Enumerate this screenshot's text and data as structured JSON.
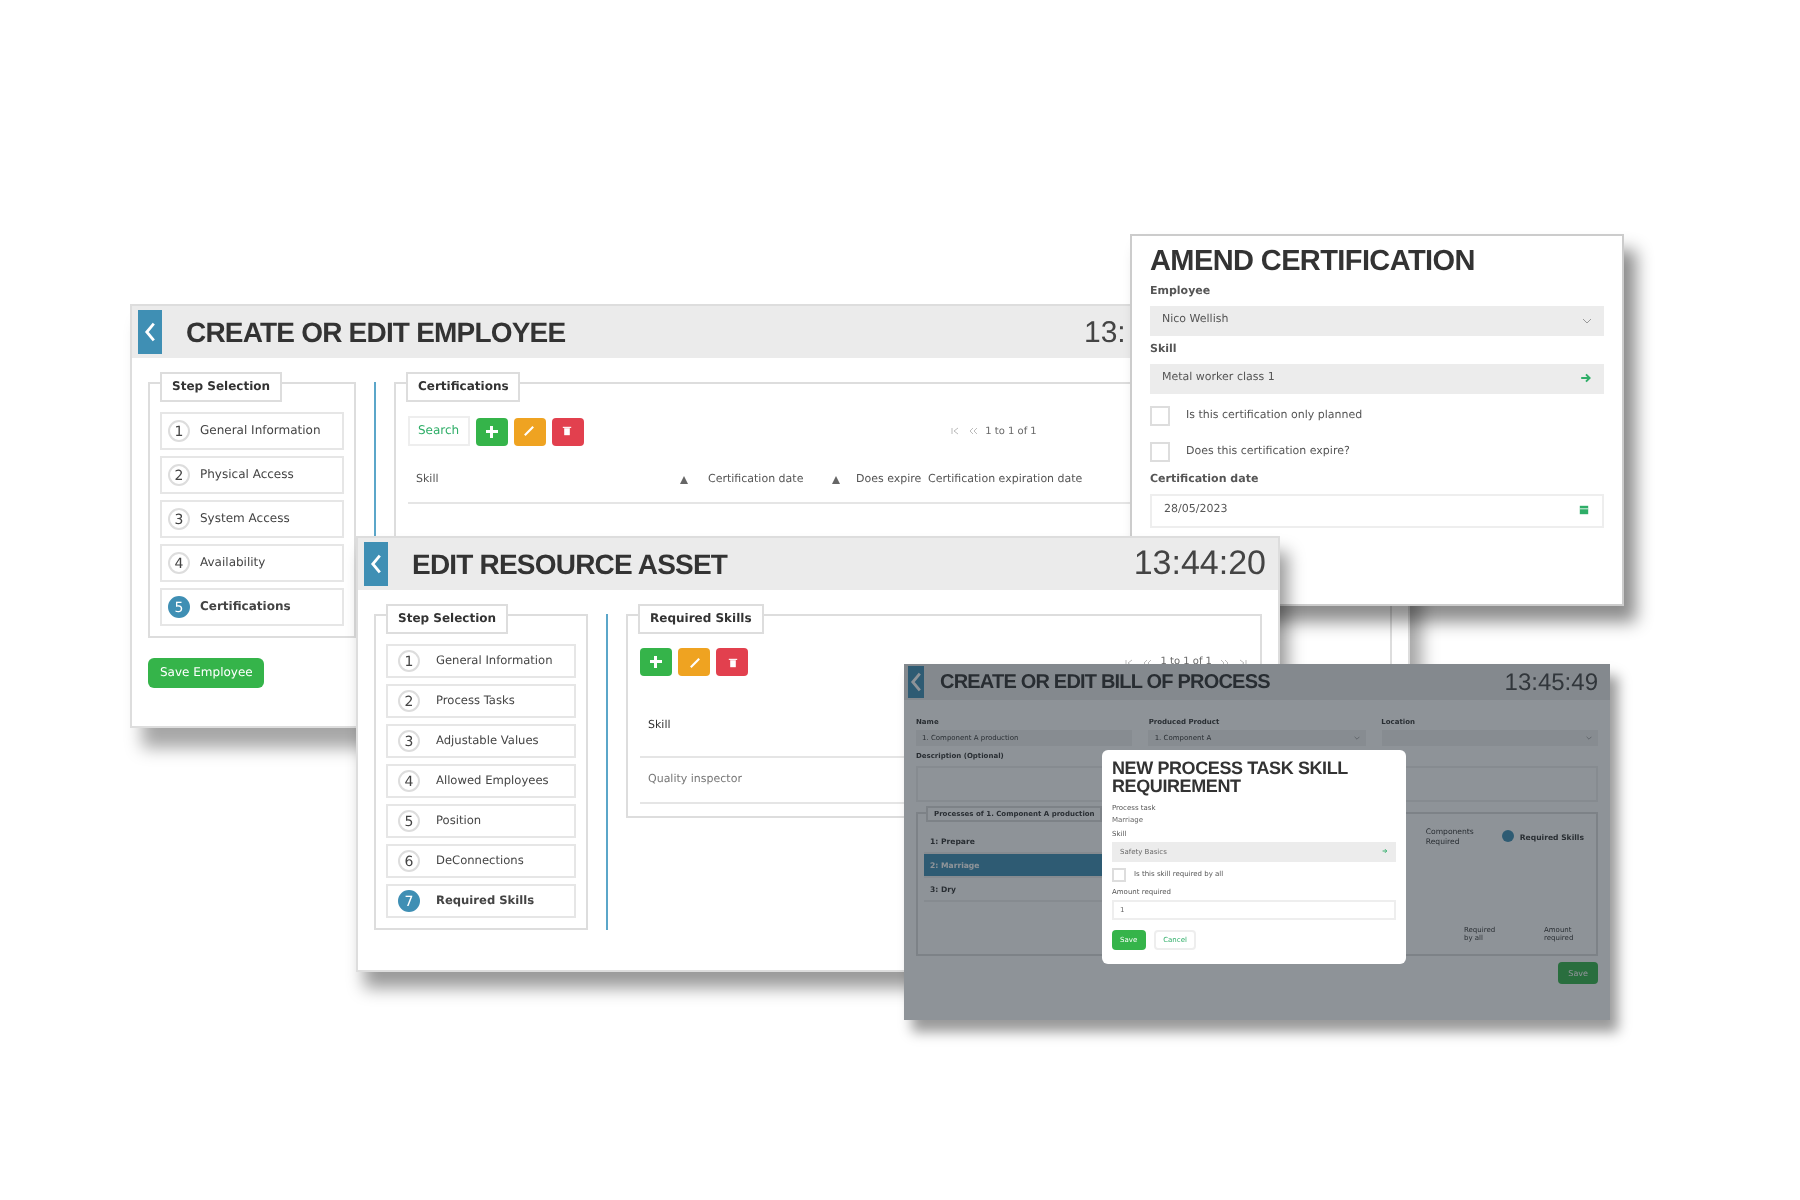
{
  "employee_window": {
    "title": "CREATE OR EDIT EMPLOYEE",
    "clock": "13:",
    "steps_title": "Step Selection",
    "steps": [
      {
        "number": "1",
        "label": "General Information",
        "selected": false
      },
      {
        "number": "2",
        "label": "Physical Access",
        "selected": false
      },
      {
        "number": "3",
        "label": "System Access",
        "selected": false
      },
      {
        "number": "4",
        "label": "Availability",
        "selected": false
      },
      {
        "number": "5",
        "label": "Certifications",
        "selected": true
      }
    ],
    "save_button": "Save Employee",
    "panel_title": "Certifications",
    "search_button": "Search",
    "pager": "1 to 1 of 1",
    "columns": [
      {
        "label": "Skill",
        "sortable": true
      },
      {
        "label": "Certification date",
        "sortable": true
      },
      {
        "label": "Does expire",
        "sortable": false
      },
      {
        "label": "Certification expiration date",
        "sortable": false
      }
    ]
  },
  "amend_certification_dialog": {
    "title": "AMEND CERTIFICATION",
    "fields": [
      {
        "kind": "select",
        "label": "Employee",
        "value": "Nico Wellish"
      },
      {
        "kind": "lookup",
        "label": "Skill",
        "value": "Metal worker class 1"
      },
      {
        "kind": "checkbox",
        "label": "Is this certification only planned",
        "checked": false
      },
      {
        "kind": "checkbox",
        "label": "Does this certification expire?",
        "checked": false
      },
      {
        "kind": "date",
        "label": "Certification date",
        "value": "28/05/2023"
      }
    ]
  },
  "resource_asset_window": {
    "title": "EDIT RESOURCE ASSET",
    "clock": "13:44:20",
    "steps_title": "Step Selection",
    "steps": [
      {
        "number": "1",
        "label": "General Information",
        "selected": false
      },
      {
        "number": "2",
        "label": "Process Tasks",
        "selected": false
      },
      {
        "number": "3",
        "label": "Adjustable Values",
        "selected": false
      },
      {
        "number": "4",
        "label": "Allowed Employees",
        "selected": false
      },
      {
        "number": "5",
        "label": "Position",
        "selected": false
      },
      {
        "number": "6",
        "label": "DeConnections",
        "selected": false
      },
      {
        "number": "7",
        "label": "Required Skills",
        "selected": true
      }
    ],
    "panel_title": "Required Skills",
    "pager": "1 to 1 of 1",
    "columns": [
      "Skill"
    ],
    "rows": [
      "Quality inspector"
    ]
  },
  "bill_of_process_window": {
    "title": "CREATE OR EDIT BILL OF PROCESS",
    "clock": "13:45:49",
    "fields": [
      {
        "kind": "text",
        "label": "Name",
        "value": "1. Component A production"
      },
      {
        "kind": "select",
        "label": "Produced Product",
        "value": "1. Component A"
      },
      {
        "kind": "select",
        "label": "Location"
      }
    ],
    "description_label": "Description (Optional)",
    "processes_title": "Processes of 1. Component A production",
    "processes": [
      {
        "label": "1: Prepare",
        "selected": false
      },
      {
        "label": "2: Marriage",
        "selected": true
      },
      {
        "label": "3: Dry",
        "selected": false
      }
    ],
    "tabs": [
      {
        "label": "Components Required",
        "selected": false
      },
      {
        "label": "Required Skills",
        "selected": true
      }
    ],
    "columns": [
      "Required by all",
      "Amount required"
    ],
    "save_button": "Save",
    "dialog": {
      "title": "NEW PROCESS TASK SKILL REQUIREMENT",
      "fields": [
        {
          "kind": "static",
          "label": "Process task",
          "value": "Marriage"
        },
        {
          "kind": "lookup",
          "label": "Skill",
          "value": "Safety Basics"
        },
        {
          "kind": "checkbox",
          "label": "Is this skill required by all",
          "checked": false
        },
        {
          "kind": "text",
          "label": "Amount required",
          "value": "1"
        }
      ],
      "buttons": [
        {
          "label": "Save",
          "kind": "primary"
        },
        {
          "label": "Cancel",
          "kind": "secondary"
        }
      ]
    }
  }
}
